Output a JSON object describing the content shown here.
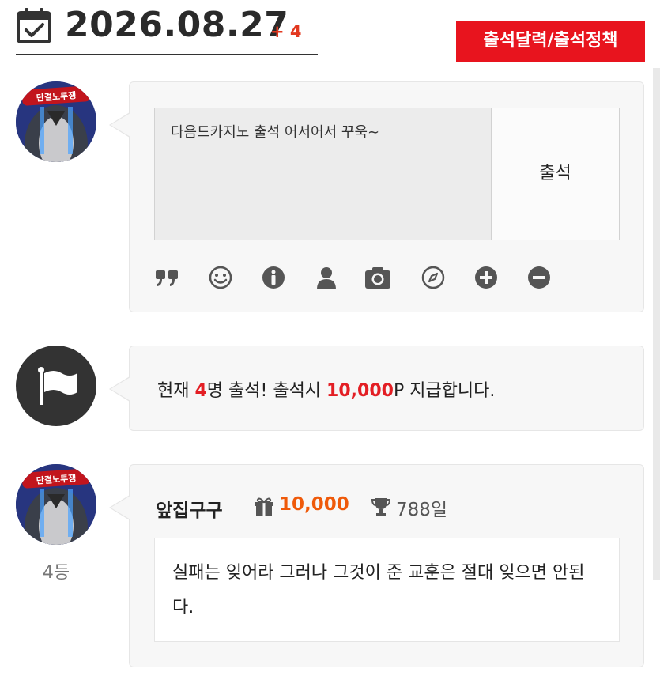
{
  "header": {
    "date": "2026.08.27",
    "count_badge": "+ 4",
    "policy_button": "출석달력/출석정책"
  },
  "attendance_form": {
    "text_value": "다음드카지노 출석 어서어서 꾸욱~",
    "submit_label": "출석",
    "toolbar_icons": [
      "quote-icon",
      "smile-icon",
      "info-icon",
      "user-icon",
      "camera-icon",
      "compass-icon",
      "plus-circle-icon",
      "minus-circle-icon"
    ]
  },
  "notice": {
    "prefix": "현재 ",
    "count": "4",
    "middle": "명 출석! 출석시 ",
    "points": "10,000",
    "suffix": "P 지급합니다."
  },
  "entry": {
    "username": "앞집구구",
    "points": "10,000",
    "days": "788일",
    "comment": "실패는 잊어라 그러나 그것이 준 교훈은 절대 잊으면 안된다.",
    "rank": "4등",
    "avatar_banner_text": "단결노투쟁"
  },
  "colors": {
    "accent_red": "#e8141e",
    "points_orange": "#ef5a0a"
  }
}
